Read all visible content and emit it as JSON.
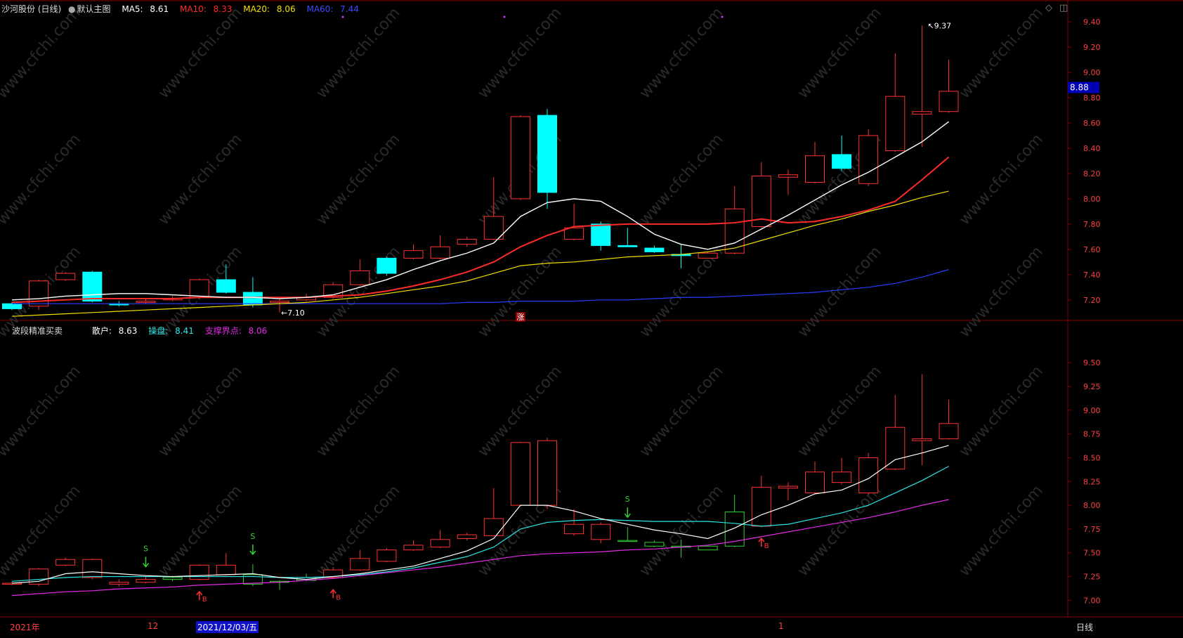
{
  "header": {
    "stock_name": "沙河股份 (日线)",
    "chart_mode": "默认主图",
    "ma5": {
      "label": "MA5:",
      "value": "8.61",
      "color": "#ffffff"
    },
    "ma10": {
      "label": "MA10:",
      "value": "8.33",
      "color": "#ff2a2a"
    },
    "ma20": {
      "label": "MA20:",
      "value": "8.06",
      "color": "#f0e000"
    },
    "ma60": {
      "label": "MA60:",
      "value": "7.44",
      "color": "#2a3cff"
    }
  },
  "lower_header": {
    "indicator_name": "波段精准买卖",
    "retail": {
      "label": "散户:",
      "value": "8.63",
      "color": "#ffffff"
    },
    "trader": {
      "label": "操盘:",
      "value": "8.41",
      "color": "#2ae6e6"
    },
    "support": {
      "label": "支撑界点:",
      "value": "8.06",
      "color": "#e62ae6"
    }
  },
  "bottom_bar": {
    "year_label": "2021年",
    "month_label_12": "12",
    "cursor_date": "2021/12/03/五",
    "month_label_1": "1",
    "period": "日线"
  },
  "colors": {
    "up": "#ff3232",
    "down": "#00ffff",
    "lower_down": "#32d232",
    "grid_red": "#8b0000",
    "axis_text": "#ff4040",
    "price_tag_bg": "#0000b4"
  },
  "chart_data": [
    {
      "type": "candlestick",
      "name": "main",
      "y_ticks": [
        "9.40",
        "9.20",
        "9.00",
        "8.80",
        "8.60",
        "8.40",
        "8.20",
        "8.00",
        "7.80",
        "7.60",
        "7.40",
        "7.20"
      ],
      "y_tick_values": [
        9.4,
        9.2,
        9.0,
        8.8,
        8.6,
        8.4,
        8.2,
        8.0,
        7.8,
        7.6,
        7.4,
        7.2
      ],
      "ylim": [
        7.06,
        9.45
      ],
      "current_price": "8.88",
      "max_label": "9.37",
      "min_label": "7.10",
      "marker": "涨",
      "candles": [
        {
          "o": 7.17,
          "c": 7.13,
          "h": 7.18,
          "l": 7.12
        },
        {
          "o": 7.15,
          "c": 7.35,
          "h": 7.36,
          "l": 7.12
        },
        {
          "o": 7.36,
          "c": 7.41,
          "h": 7.42,
          "l": 7.35
        },
        {
          "o": 7.42,
          "c": 7.19,
          "h": 7.43,
          "l": 7.18
        },
        {
          "o": 7.17,
          "c": 7.16,
          "h": 7.19,
          "l": 7.15
        },
        {
          "o": 7.18,
          "c": 7.19,
          "h": 7.21,
          "l": 7.17
        },
        {
          "o": 7.2,
          "c": 7.21,
          "h": 7.23,
          "l": 7.19
        },
        {
          "o": 7.22,
          "c": 7.36,
          "h": 7.37,
          "l": 7.21
        },
        {
          "o": 7.36,
          "c": 7.26,
          "h": 7.48,
          "l": 7.25
        },
        {
          "o": 7.26,
          "c": 7.16,
          "h": 7.38,
          "l": 7.14
        },
        {
          "o": 7.18,
          "c": 7.19,
          "h": 7.21,
          "l": 7.1
        },
        {
          "o": 7.2,
          "c": 7.22,
          "h": 7.25,
          "l": 7.19
        },
        {
          "o": 7.22,
          "c": 7.32,
          "h": 7.34,
          "l": 7.21
        },
        {
          "o": 7.32,
          "c": 7.43,
          "h": 7.52,
          "l": 7.31
        },
        {
          "o": 7.53,
          "c": 7.41,
          "h": 7.54,
          "l": 7.39
        },
        {
          "o": 7.53,
          "c": 7.59,
          "h": 7.64,
          "l": 7.52
        },
        {
          "o": 7.53,
          "c": 7.62,
          "h": 7.71,
          "l": 7.52
        },
        {
          "o": 7.64,
          "c": 7.68,
          "h": 7.7,
          "l": 7.62
        },
        {
          "o": 7.68,
          "c": 7.86,
          "h": 8.17,
          "l": 7.67
        },
        {
          "o": 8.0,
          "c": 8.65,
          "h": 8.66,
          "l": 7.99
        },
        {
          "o": 8.66,
          "c": 8.05,
          "h": 8.71,
          "l": 7.92
        },
        {
          "o": 7.68,
          "c": 7.77,
          "h": 7.96,
          "l": 7.67
        },
        {
          "o": 7.8,
          "c": 7.63,
          "h": 7.82,
          "l": 7.59
        },
        {
          "o": 7.63,
          "c": 7.62,
          "h": 7.77,
          "l": 7.62
        },
        {
          "o": 7.61,
          "c": 7.58,
          "h": 7.63,
          "l": 7.57
        },
        {
          "o": 7.56,
          "c": 7.55,
          "h": 7.64,
          "l": 7.45
        },
        {
          "o": 7.53,
          "c": 7.57,
          "h": 7.58,
          "l": 7.53
        },
        {
          "o": 7.57,
          "c": 7.92,
          "h": 8.1,
          "l": 7.56
        },
        {
          "o": 7.78,
          "c": 8.18,
          "h": 8.29,
          "l": 7.77
        },
        {
          "o": 8.17,
          "c": 8.19,
          "h": 8.23,
          "l": 8.03
        },
        {
          "o": 8.13,
          "c": 8.34,
          "h": 8.45,
          "l": 8.12
        },
        {
          "o": 8.35,
          "c": 8.24,
          "h": 8.5,
          "l": 8.22
        },
        {
          "o": 8.12,
          "c": 8.5,
          "h": 8.55,
          "l": 8.1
        },
        {
          "o": 8.38,
          "c": 8.81,
          "h": 9.15,
          "l": 8.37
        },
        {
          "o": 8.67,
          "c": 8.69,
          "h": 9.37,
          "l": 8.41
        },
        {
          "o": 8.69,
          "c": 8.85,
          "h": 9.1,
          "l": 8.68
        }
      ],
      "ma5": [
        7.2,
        7.21,
        7.23,
        7.24,
        7.25,
        7.25,
        7.24,
        7.23,
        7.22,
        7.22,
        7.21,
        7.22,
        7.24,
        7.3,
        7.36,
        7.44,
        7.51,
        7.57,
        7.65,
        7.86,
        7.97,
        8.0,
        7.98,
        7.86,
        7.72,
        7.64,
        7.6,
        7.65,
        7.76,
        7.87,
        7.99,
        8.11,
        8.21,
        8.33,
        8.45,
        8.61
      ],
      "ma10": [
        7.18,
        7.19,
        7.2,
        7.21,
        7.21,
        7.21,
        7.21,
        7.22,
        7.22,
        7.22,
        7.22,
        7.22,
        7.23,
        7.24,
        7.27,
        7.31,
        7.36,
        7.42,
        7.5,
        7.62,
        7.71,
        7.78,
        7.79,
        7.8,
        7.8,
        7.8,
        7.8,
        7.81,
        7.84,
        7.81,
        7.82,
        7.86,
        7.91,
        7.98,
        8.15,
        8.33
      ],
      "ma20": [
        7.07,
        7.08,
        7.09,
        7.1,
        7.11,
        7.12,
        7.13,
        7.14,
        7.15,
        7.16,
        7.17,
        7.18,
        7.2,
        7.22,
        7.25,
        7.28,
        7.31,
        7.35,
        7.41,
        7.47,
        7.49,
        7.5,
        7.52,
        7.54,
        7.55,
        7.56,
        7.58,
        7.61,
        7.67,
        7.73,
        7.79,
        7.84,
        7.9,
        7.95,
        8.01,
        8.06
      ],
      "ma60": [
        7.17,
        7.17,
        7.17,
        7.17,
        7.17,
        7.17,
        7.17,
        7.17,
        7.17,
        7.17,
        7.17,
        7.17,
        7.17,
        7.17,
        7.17,
        7.17,
        7.17,
        7.18,
        7.18,
        7.19,
        7.19,
        7.19,
        7.2,
        7.2,
        7.21,
        7.22,
        7.22,
        7.23,
        7.24,
        7.25,
        7.26,
        7.28,
        7.3,
        7.33,
        7.38,
        7.44
      ]
    },
    {
      "type": "candlestick",
      "name": "lower",
      "y_ticks": [
        "9.50",
        "9.25",
        "9.00",
        "8.75",
        "8.50",
        "8.25",
        "8.00",
        "7.75",
        "7.50",
        "7.25",
        "7.00"
      ],
      "y_tick_values": [
        9.5,
        9.25,
        9.0,
        8.75,
        8.5,
        8.25,
        8.0,
        7.75,
        7.5,
        7.25,
        7.0
      ],
      "ylim": [
        6.84,
        9.62
      ],
      "retail_line": [
        7.18,
        7.2,
        7.28,
        7.3,
        7.28,
        7.26,
        7.25,
        7.26,
        7.27,
        7.28,
        7.24,
        7.22,
        7.25,
        7.28,
        7.32,
        7.36,
        7.44,
        7.52,
        7.65,
        8.0,
        8.0,
        7.94,
        7.86,
        7.8,
        7.74,
        7.7,
        7.65,
        7.76,
        7.9,
        8.0,
        8.12,
        8.16,
        8.28,
        8.48,
        8.55,
        8.63
      ],
      "trader_line": [
        7.2,
        7.22,
        7.24,
        7.25,
        7.25,
        7.25,
        7.25,
        7.25,
        7.25,
        7.25,
        7.24,
        7.24,
        7.25,
        7.27,
        7.3,
        7.34,
        7.4,
        7.46,
        7.56,
        7.75,
        7.82,
        7.84,
        7.85,
        7.84,
        7.83,
        7.83,
        7.83,
        7.81,
        7.78,
        7.8,
        7.86,
        7.92,
        8.0,
        8.13,
        8.26,
        8.41
      ],
      "support_line": [
        7.05,
        7.07,
        7.09,
        7.1,
        7.12,
        7.13,
        7.14,
        7.16,
        7.17,
        7.18,
        7.19,
        7.21,
        7.23,
        7.26,
        7.29,
        7.32,
        7.35,
        7.39,
        7.43,
        7.47,
        7.49,
        7.5,
        7.51,
        7.53,
        7.54,
        7.56,
        7.58,
        7.62,
        7.67,
        7.72,
        7.77,
        7.82,
        7.87,
        7.93,
        8.0,
        8.06
      ],
      "signals": [
        {
          "i": 5,
          "kind": "S"
        },
        {
          "i": 9,
          "kind": "S"
        },
        {
          "i": 23,
          "kind": "S"
        },
        {
          "i": 7,
          "kind": "B"
        },
        {
          "i": 12,
          "kind": "B"
        },
        {
          "i": 28,
          "kind": "B"
        }
      ],
      "candles": [
        {
          "o": 7.18,
          "c": 7.17,
          "h": 7.19,
          "l": 7.16
        },
        {
          "o": 7.17,
          "c": 7.33,
          "h": 7.34,
          "l": 7.15
        },
        {
          "o": 7.37,
          "c": 7.43,
          "h": 7.45,
          "l": 7.36
        },
        {
          "o": 7.43,
          "c": 7.24,
          "h": 7.44,
          "l": 7.22
        },
        {
          "o": 7.17,
          "c": 7.19,
          "h": 7.22,
          "l": 7.15
        },
        {
          "o": 7.19,
          "c": 7.22,
          "h": 7.25,
          "l": 7.18
        },
        {
          "o": 7.22,
          "c": 7.24,
          "h": 7.26,
          "l": 7.2,
          "g": 1
        },
        {
          "o": 7.22,
          "c": 7.37,
          "h": 7.38,
          "l": 7.21
        },
        {
          "o": 7.27,
          "c": 7.37,
          "h": 7.5,
          "l": 7.26
        },
        {
          "o": 7.27,
          "c": 7.17,
          "h": 7.38,
          "l": 7.15,
          "g": 1
        },
        {
          "o": 7.2,
          "c": 7.19,
          "h": 7.21,
          "l": 7.11,
          "g": 1
        },
        {
          "o": 7.21,
          "c": 7.24,
          "h": 7.28,
          "l": 7.2,
          "g": 1
        },
        {
          "o": 7.24,
          "c": 7.32,
          "h": 7.35,
          "l": 7.23
        },
        {
          "o": 7.32,
          "c": 7.44,
          "h": 7.53,
          "l": 7.31
        },
        {
          "o": 7.41,
          "c": 7.53,
          "h": 7.55,
          "l": 7.4
        },
        {
          "o": 7.53,
          "c": 7.58,
          "h": 7.63,
          "l": 7.52
        },
        {
          "o": 7.56,
          "c": 7.64,
          "h": 7.74,
          "l": 7.55
        },
        {
          "o": 7.65,
          "c": 7.69,
          "h": 7.71,
          "l": 7.63
        },
        {
          "o": 7.68,
          "c": 7.86,
          "h": 8.18,
          "l": 7.67
        },
        {
          "o": 8.0,
          "c": 8.66,
          "h": 8.67,
          "l": 7.99
        },
        {
          "o": 8.0,
          "c": 8.68,
          "h": 8.71,
          "l": 7.96
        },
        {
          "o": 7.7,
          "c": 7.8,
          "h": 7.96,
          "l": 7.68
        },
        {
          "o": 7.64,
          "c": 7.8,
          "h": 7.82,
          "l": 7.6
        },
        {
          "o": 7.63,
          "c": 7.63,
          "h": 7.77,
          "l": 7.62,
          "g": 1
        },
        {
          "o": 7.57,
          "c": 7.61,
          "h": 7.63,
          "l": 7.56,
          "g": 1
        },
        {
          "o": 7.57,
          "c": 7.57,
          "h": 7.64,
          "l": 7.45,
          "g": 1
        },
        {
          "o": 7.53,
          "c": 7.57,
          "h": 7.58,
          "l": 7.53,
          "g": 1
        },
        {
          "o": 7.57,
          "c": 7.93,
          "h": 8.11,
          "l": 7.56,
          "g": 1
        },
        {
          "o": 7.78,
          "c": 8.19,
          "h": 8.31,
          "l": 7.77
        },
        {
          "o": 8.18,
          "c": 8.2,
          "h": 8.24,
          "l": 8.05
        },
        {
          "o": 8.13,
          "c": 8.35,
          "h": 8.46,
          "l": 8.12
        },
        {
          "o": 8.24,
          "c": 8.35,
          "h": 8.5,
          "l": 8.22
        },
        {
          "o": 8.13,
          "c": 8.5,
          "h": 8.55,
          "l": 8.11
        },
        {
          "o": 8.38,
          "c": 8.82,
          "h": 9.16,
          "l": 8.37
        },
        {
          "o": 8.68,
          "c": 8.7,
          "h": 9.38,
          "l": 8.42
        },
        {
          "o": 8.7,
          "c": 8.86,
          "h": 9.11,
          "l": 8.69
        }
      ]
    }
  ]
}
